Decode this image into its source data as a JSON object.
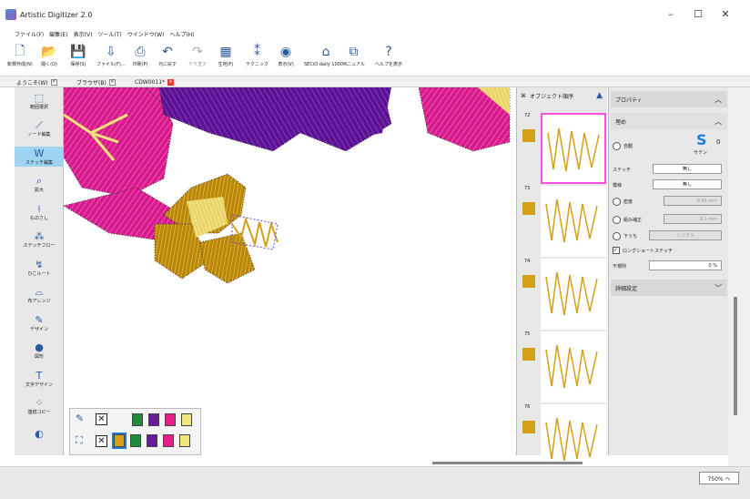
{
  "window": {
    "title": "Artistic Digitizer 2.0",
    "minimize": "–",
    "maximize": "☐",
    "close": "✕"
  },
  "menu": [
    "ファイル(F)",
    "編集(E)",
    "表示(V)",
    "ツール(T)",
    "ウインドウ(W)",
    "ヘルプ(H)"
  ],
  "toolbar": [
    {
      "label": "新規作成(N)",
      "icon": "new-file-icon",
      "glyph": "🗋"
    },
    {
      "label": "開く(O)",
      "icon": "open-folder-icon",
      "glyph": "📂"
    },
    {
      "label": "保存(S)",
      "icon": "save-icon",
      "glyph": "💾"
    },
    {
      "label": "ファイル(F)...",
      "icon": "file-export-icon",
      "glyph": "⇩"
    },
    {
      "label": "印刷(P)",
      "icon": "print-icon",
      "glyph": "⎙"
    },
    {
      "label": "元に戻す",
      "icon": "undo-icon",
      "glyph": "↶"
    },
    {
      "label": "やり直す",
      "icon": "redo-icon",
      "glyph": "↷",
      "disabled": true
    },
    {
      "label": "生地(F)",
      "icon": "fabric-icon",
      "glyph": "▦"
    },
    {
      "label": "テクニック",
      "icon": "technique-icon",
      "glyph": "⁑"
    },
    {
      "label": "表示(V)",
      "icon": "view-icon",
      "glyph": "◉"
    },
    {
      "label": "SECiO daily 1000へ",
      "icon": "send-to-machine-icon",
      "glyph": "⌂"
    },
    {
      "label": "マニュアル",
      "icon": "manual-icon",
      "glyph": "⧉"
    },
    {
      "label": "ヘルプを表示",
      "icon": "help-icon",
      "glyph": "?"
    }
  ],
  "tabs": [
    {
      "label": "ようこそ(W)",
      "close": "×"
    },
    {
      "label": "ブラウザ(B)",
      "close": "×"
    },
    {
      "label": "CDW0011*",
      "close": "×"
    }
  ],
  "tools": [
    {
      "label": "範囲選択",
      "icon": "select-icon",
      "glyph": "⬚"
    },
    {
      "label": "ノード編集",
      "icon": "node-edit-icon",
      "glyph": "⟋"
    },
    {
      "label": "ステッチ編集",
      "icon": "stitch-edit-icon",
      "glyph": "W",
      "active": true
    },
    {
      "label": "拡大",
      "icon": "zoom-icon",
      "glyph": "⌕"
    },
    {
      "label": "ものさし",
      "icon": "ruler-icon",
      "glyph": "⟊"
    },
    {
      "label": "ステッチフロー",
      "icon": "stitch-flow-icon",
      "glyph": "⁂"
    },
    {
      "label": "ひこルート",
      "icon": "route-icon",
      "glyph": "↯"
    },
    {
      "label": "布アレンジ",
      "icon": "fabric-arrange-icon",
      "glyph": "⌓"
    },
    {
      "label": "デザイン",
      "icon": "design-icon",
      "glyph": "✎"
    },
    {
      "label": "図形",
      "icon": "shape-icon",
      "glyph": "●"
    },
    {
      "label": "文字デザイン",
      "icon": "text-icon",
      "glyph": "T"
    },
    {
      "label": "連続コピー",
      "icon": "repeat-copy-icon",
      "glyph": "⁘"
    },
    {
      "label": "",
      "icon": "more-tools-icon",
      "glyph": "◐"
    }
  ],
  "palette": {
    "row1": [
      "#1e8c3a",
      "#6a1b9a",
      "#e91e8c",
      "#f2e67a"
    ],
    "row2": [
      "#d4a017",
      "#1e8c3a",
      "#6a1b9a",
      "#e91e8c",
      "#f2e67a"
    ],
    "x": "✕"
  },
  "object_panel": {
    "title": "オブジェクト順序",
    "items": [
      {
        "num": "72",
        "color": "#d4a017",
        "selected": true
      },
      {
        "num": "73",
        "color": "#d4a017"
      },
      {
        "num": "74",
        "color": "#d4a017"
      },
      {
        "num": "75",
        "color": "#d4a017"
      },
      {
        "num": "76",
        "color": "#d4a017"
      }
    ]
  },
  "properties": {
    "title": "プロパティ",
    "section_title": "埋め",
    "auto_label": "自動",
    "satin_label": "サテン",
    "satin_value": "0",
    "stitch_label": "ステッチ",
    "stitch_value": "無し",
    "fill_label": "模様",
    "fill_value": "無し",
    "density_label": "密度",
    "density_value": "0.45 mm",
    "overlap_label": "組み補正",
    "overlap_value": "0.1 mm",
    "underlay_label": "下うち",
    "underlay_value": "シングル",
    "long_stitch_label": "ロングショートステッチ",
    "irregular_label": "不規則",
    "irregular_value": "0 %",
    "detail_label": "詳細設定"
  },
  "status": {
    "zoom": "750% ヘ"
  }
}
